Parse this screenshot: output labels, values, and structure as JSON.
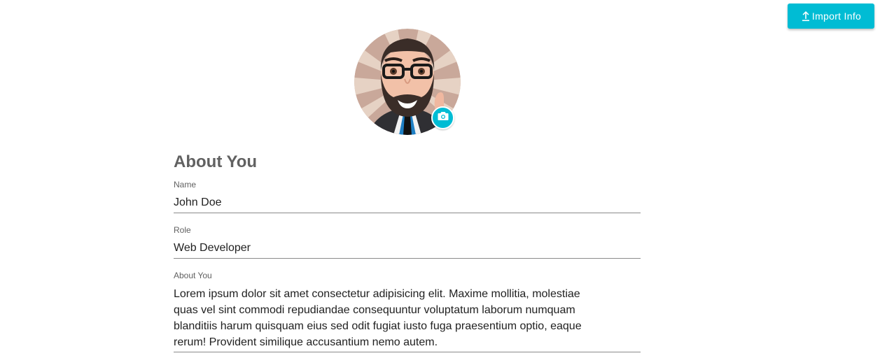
{
  "toolbar": {
    "import_label": "Import Info",
    "import_icon": "upload-icon"
  },
  "avatar": {
    "camera_icon": "camera-icon",
    "image": "cartoon bearded man with glasses"
  },
  "form": {
    "section_title": "About You",
    "name": {
      "label": "Name",
      "value": "John Doe"
    },
    "role": {
      "label": "Role",
      "value": "Web Developer"
    },
    "about": {
      "label": "About You",
      "value": "Lorem ipsum dolor sit amet consectetur adipisicing elit. Maxime mollitia, molestiae quas vel sint commodi repudiandae consequuntur voluptatum laborum numquam blanditiis harum quisquam eius sed odit fugiat iusto fuga praesentium optio, eaque rerum! Provident similique accusantium nemo autem."
    }
  },
  "colors": {
    "accent": "#00bcd4",
    "heading": "#616161",
    "text": "#212121",
    "underline": "#8a8a8a"
  }
}
